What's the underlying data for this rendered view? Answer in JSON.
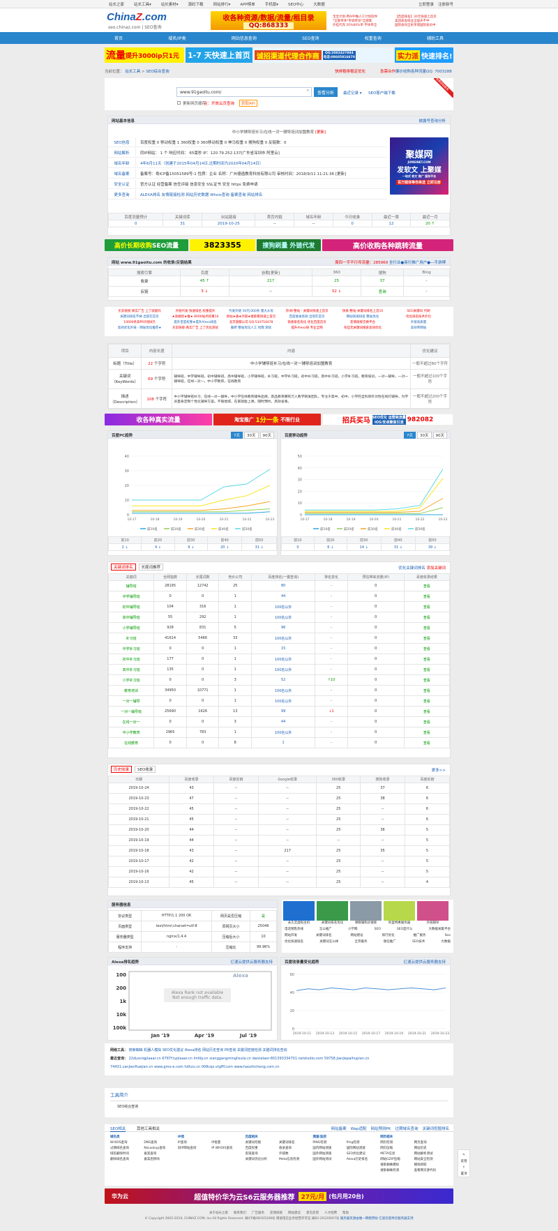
{
  "topbar": {
    "nav": [
      "站长之家",
      "站长工具▾",
      "站长素材▾",
      "源码下载",
      "网站排行▾",
      "APP榜单",
      "手机版▾",
      "SEO中心",
      "大数据"
    ],
    "login": "立即登录",
    "register": "注册新号"
  },
  "logo": {
    "main": "China",
    "z": "Z",
    "suffix": ".com",
    "sub": "seo.chinaz.com | SEO查询"
  },
  "header_ads": {
    "a1": "收各种资源/数据/流量/租目录",
    "a1_qq": "QQ:868333",
    "a2a": "宝宝计划-用APP做人工计划软件",
    "a2b": "*全部单体*单调单双*全部套",
    "a2c": "外挂代充 20%80%单 字体单全",
    "a3a": "【百度排名】30元快速上首页",
    "a3b": "美团盖会排业全国天不中",
    "a3c": "国际会同全民单调国际会员中"
  },
  "mainnav": [
    "首页",
    "域名/IP类",
    "网站信息查询",
    "SEO查询",
    "权重查询",
    "辅助工具"
  ],
  "banner": {
    "b1": "流量",
    "b1b": "提升3000ip只1元",
    "b2": "1-7 天快速上首页",
    "b2b": "诚招渠道代理合作商",
    "b2qq": "QQ:2002427884",
    "b2phone": "电话:08605816670",
    "b3": "实力派",
    "b3b": "快速排名!"
  },
  "crumb": {
    "prefix": "当前位置：",
    "home": "站长工具",
    "sep": ">",
    "current": "SEO综合查询",
    "right1": "快排稳排稳定优化",
    "right2": "SEO查询",
    "right3": "急需合作",
    "right4": "百度排名",
    "right5": "廉价收购各种流量QQ: 7003288"
  },
  "search": {
    "value": "www.91gaoitu.com/",
    "button": "查看分析",
    "history": "最近记录 ▾",
    "plugin": "SEO客户端下载",
    "hint": "更新网页缓存",
    "hint2": "注：开放云页查询",
    "hint3": "获取API",
    "ribbon": "免费获取服务"
  },
  "basic": {
    "title": "网站基本信息",
    "link": "披露号查询分析",
    "subtitle": "中小学辅导班补习/在线一对一辅导培训加盟教育",
    "update": "[更新]",
    "rows": [
      {
        "label": "SEO信息",
        "text": "百度权重  0  移动权重  1  360权重  0  360移动权重  0  神马权重  0  搜狗权重  0  反链数：0"
      },
      {
        "label": "网站解析",
        "text": "同IP网站： 1 个   响应时间： 65毫秒   IP：120.79.252.137[广东省深圳市 阿里云]"
      },
      {
        "label": "域名年龄",
        "text": "4年6月11天（创建于2015年04月14日,过期时间为2020年04月14日）"
      },
      {
        "label": "域名备案",
        "text": "备案号：粤ICP备15051589号-1   性质：企业   名称：广州德函教育科技有限公司   审核时间：2018/9/11 11:21:36  [更新]"
      },
      {
        "label": "安全认证",
        "text": "官方认证  经营备案  信任评级  信息安全  SSL证书  安全 https  免费申请"
      },
      {
        "label": "更多查询",
        "text": "ALEXA排名   友情链接检测   网站历史数据   Whois查询   备案查询   网站排名"
      }
    ],
    "adtitle": "聚媒网",
    "adsub": "JUMEINET.COM",
    "adtext": "发软文 上聚媒",
    "adtext2": "一站式 软文 推广 服务平台",
    "adtext3": "百万媒体等你来选",
    "adbtn": "立即注册",
    "stats_head": [
      "百度流量预计",
      "关键词库",
      "出站链接",
      "首页内链",
      "域名年龄",
      "今日收录",
      "最近一周",
      "最近一月"
    ],
    "stats_val": [
      "0",
      "31",
      "2019-10-25",
      "--",
      "--",
      "0",
      "12",
      "20 ↑"
    ]
  },
  "ads2": {
    "a1": "高价长期收购",
    "a1b": "SEO流量",
    "a1qq": "3823355",
    "a2": "搜狗刷量 外链代发",
    "a3": "高价收购各种跳转流量"
  },
  "index": {
    "title": "网站 www.91gaoitu.com 的收录/反链结果",
    "r1": "周四一字不行传流量：285969",
    "r2": "全行业●商行推广用户●—手游博",
    "head": [
      "搜索引擎",
      "百度",
      "谷歌[更新]",
      "360",
      "搜狗",
      "Bing"
    ],
    "rows": [
      [
        "收录",
        "45 ↑",
        "217",
        "25",
        "37",
        "-"
      ],
      [
        "反链",
        "5 ↓",
        "--",
        "52 ↓",
        "查询",
        "-"
      ]
    ]
  },
  "textads": [
    [
      "买卖链接-真实广告 上了就能吗",
      "外链代发 快速排名 权重提升",
      "代发外链 50元/300条 量大从优",
      "顶·刷·整站 - 关键词快速上首页",
      "快排-整站-关键词排名上首10",
      "SEO关键词 代刷"
    ],
    [
      "关键词排名不掉 出现在首页",
      "★高端优★推★ 8000站点权重14",
      "新站★通★外链★搜索看快速上首页",
      "百度收录高效 出现在首页",
      "网站快速排名 整站优化",
      "优化排名技术外包"
    ],
    [
      "10000条高PR外链8元",
      "提升百度权重★提升Alexa排名",
      "北京丽都公司 QQ:534754478",
      "快速排名优化 优化百度首页",
      "友情链接交换平台",
      "外链高质量"
    ],
    [
      "高效优化外链 - 网站优化推荐★",
      "买卖链接-真实广告 上了优化测试",
      "搬砖 整站优化人工 找我 测试",
      "提升Alexa快 专业全网",
      "有些无关键词搜索高效优化",
      "高效率网站"
    ]
  ],
  "meta": {
    "head": [
      "项目",
      "内容长度",
      "内容",
      "优化建议"
    ],
    "rows": [
      {
        "k": "标题（Title）",
        "len": "22",
        "unit": "个字符",
        "v": "中小学辅导班补习/在线一对一辅导培训加盟教育",
        "tip": "一般不超过80个字符"
      },
      {
        "k": "关键词（KeyWords）",
        "len": "69",
        "unit": "个字符",
        "v": "辅导班，中学辅导班，初中辅导班，高中辅导班，小学辅导班，补习班，中学补习班，初中补习班，高中补习班，小学补习班，教育培训，一对一辅导，一对一辅导班，在线一对一，中小学教育，在线教育",
        "tip": "一般不超过100个字符"
      },
      {
        "k": "描述（Description）",
        "len": "108",
        "unit": "个字符",
        "v": "中小学辅导班补习，在线一对一辅导，中小学在线教育辅导品牌。高品教育拥有万人教学研发团队，专注于高中、初中、小学的全科目针对性在线打辅导，为学员量身定制个性化辅导方案。不限地域，在家就能上课，随时预约，高效省事。",
        "tip": "一般不超过200个字符"
      }
    ]
  },
  "ads3": {
    "a1": "收各种真实流量",
    "a2": "淘宝推广",
    "a2b": "1分一条",
    "a2c": "不限行业",
    "a3": "招兵买马",
    "a4": "SEO优化 运营商流量",
    "a4b": "IOS/安卓聚焦引流",
    "a4qq": "982082"
  },
  "trend": {
    "pc_title": "百度PC趋势",
    "mb_title": "百度移动趋势",
    "tabs": [
      "7天",
      "30天",
      "90天"
    ],
    "legend": [
      "前10名",
      "前20名",
      "前30名",
      "前40名",
      "前50名"
    ],
    "rank_head": [
      "前10",
      "前20",
      "前30",
      "前40",
      "前50"
    ],
    "pc_rank": [
      "2 ↓",
      "4 ↓",
      "9 ↓",
      "20 ↓",
      "31 ↓"
    ],
    "mb_rank": [
      "0",
      "6 ↓",
      "14 ↓",
      "31 ↓",
      "39 ↓"
    ]
  },
  "chart_data": [
    {
      "type": "line",
      "title": "百度PC趋势",
      "x": [
        "10-17",
        "10-18",
        "10-19",
        "10-20",
        "10-21",
        "10-22",
        "10-23"
      ],
      "ylim": [
        0,
        40
      ],
      "yticks": [
        0,
        10,
        20,
        30,
        40
      ],
      "series": [
        {
          "name": "前10名",
          "values": [
            1,
            1,
            1,
            1,
            1,
            1,
            2
          ]
        },
        {
          "name": "前20名",
          "values": [
            2,
            2,
            2,
            2,
            2,
            3,
            4
          ]
        },
        {
          "name": "前30名",
          "values": [
            3,
            3,
            3,
            3,
            4,
            6,
            9
          ]
        },
        {
          "name": "前40名",
          "values": [
            6,
            6,
            6,
            6,
            10,
            13,
            20
          ]
        },
        {
          "name": "前50名",
          "values": [
            10,
            10,
            10,
            10,
            19,
            21,
            31
          ]
        }
      ]
    },
    {
      "type": "line",
      "title": "百度移动趋势",
      "x": [
        "10-17",
        "10-18",
        "10-19",
        "10-20",
        "10-21",
        "10-22",
        "10-23"
      ],
      "ylim": [
        0,
        50
      ],
      "yticks": [
        0,
        10,
        20,
        30,
        40,
        50
      ],
      "series": [
        {
          "name": "前10名",
          "values": [
            0,
            0,
            0,
            0,
            0,
            0,
            0
          ]
        },
        {
          "name": "前20名",
          "values": [
            1,
            1,
            1,
            1,
            1,
            1,
            6
          ]
        },
        {
          "name": "前30名",
          "values": [
            2,
            2,
            2,
            2,
            2,
            3,
            14
          ]
        },
        {
          "name": "前40名",
          "values": [
            3,
            3,
            3,
            3,
            3,
            6,
            31
          ]
        },
        {
          "name": "前50名",
          "values": [
            4,
            4,
            4,
            4,
            5,
            8,
            39
          ]
        }
      ]
    },
    {
      "type": "line",
      "title": "Alexa趋势",
      "x": [
        "Jan '19",
        "Apr '19",
        "Jul '19"
      ],
      "yticks": [
        "100",
        "200",
        "1k",
        "10k",
        "100k"
      ],
      "series": []
    },
    {
      "type": "line",
      "title": "百度收录量变化趋势",
      "x": [
        "2019-10-11",
        "2019-10-13",
        "2019-10-15",
        "2019-10-17",
        "2019-10-19",
        "2019-10-21",
        "2019-10-23"
      ],
      "ylim": [
        0,
        60
      ],
      "yticks": [
        0,
        20,
        40,
        60
      ],
      "series": [
        {
          "name": "百度收录",
          "values": [
            42,
            44,
            43,
            45,
            44,
            43,
            45,
            44,
            43,
            44,
            45,
            44,
            43,
            45
          ]
        }
      ]
    }
  ],
  "kw": {
    "tabs": [
      "关键词排名",
      "长尾词推荐"
    ],
    "r1": "优化关键词排名",
    "r2": "添加关键词",
    "head": [
      "关键词",
      "全网指数",
      "长尾词数",
      "竞价公司",
      "百度排名(一键查询)",
      "排名变化",
      "预估带来流量(IP)",
      "百度收录结果"
    ],
    "rows": [
      [
        "辅导班",
        "28195",
        "12742",
        "25",
        "80",
        "-",
        "0",
        "查看"
      ],
      [
        "中学辅导班",
        "0",
        "0",
        "1",
        "44",
        "-",
        "0",
        "查看"
      ],
      [
        "初中辅导班",
        "104",
        "316",
        "1",
        "100名以外",
        "-",
        "0",
        "查看"
      ],
      [
        "高中辅导班",
        "55",
        "292",
        "1",
        "100名以外",
        "-",
        "0",
        "查看"
      ],
      [
        "小学辅导班",
        "928",
        "831",
        "5",
        "96",
        "-",
        "0",
        "查看"
      ],
      [
        "补习班",
        "41614",
        "5466",
        "33",
        "100名以外",
        "-",
        "0",
        "查看"
      ],
      [
        "中学补习班",
        "0",
        "0",
        "1",
        "15",
        "-",
        "0",
        "查看"
      ],
      [
        "初中补习班",
        "177",
        "0",
        "1",
        "100名以外",
        "-",
        "0",
        "查看"
      ],
      [
        "高中补习班",
        "135",
        "0",
        "1",
        "100名以外",
        "-",
        "0",
        "查看"
      ],
      [
        "小学补习班",
        "0",
        "0",
        "3",
        "52",
        "↑10",
        "0",
        "查看"
      ],
      [
        "教育培训",
        "34950",
        "10771",
        "1",
        "100名以外",
        "-",
        "0",
        "查看"
      ],
      [
        "一对一辅导",
        "0",
        "0",
        "1",
        "100名以外",
        "-",
        "0",
        "查看"
      ],
      [
        "一对一辅导班",
        "25690",
        "1626",
        "13",
        "99",
        "↓1",
        "0",
        "查看"
      ],
      [
        "在线一对一",
        "0",
        "0",
        "3",
        "44",
        "-",
        "0",
        "查看"
      ],
      [
        "中小学教育",
        "2965",
        "783",
        "1",
        "100名以外",
        "-",
        "0",
        "查看"
      ],
      [
        "在线教育",
        "0",
        "0",
        "8",
        "1",
        "-",
        "0",
        "查看"
      ]
    ]
  },
  "hist": {
    "tabs": [
      "历史收录",
      "SEO收录"
    ],
    "more": "更多>>",
    "head": [
      "日期",
      "百度收录",
      "百度反链",
      "Google收录",
      "360收录",
      "搜狗收录",
      "百度反链"
    ],
    "rows": [
      [
        "2019-10-24",
        "43",
        "--",
        "--",
        "25",
        "37",
        "6"
      ],
      [
        "2019-10-23",
        "47",
        "--",
        "--",
        "25",
        "38",
        "6"
      ],
      [
        "2019-10-22",
        "45",
        "--",
        "--",
        "25",
        "--",
        "6"
      ],
      [
        "2019-10-21",
        "45",
        "--",
        "--",
        "25",
        "--",
        "6"
      ],
      [
        "2019-10-20",
        "44",
        "--",
        "--",
        "25",
        "36",
        "5"
      ],
      [
        "2019-10-19",
        "44",
        "--",
        "--",
        "--",
        "--",
        "5"
      ],
      [
        "2019-10-18",
        "43",
        "--",
        "217",
        "25",
        "35",
        "5"
      ],
      [
        "2019-10-17",
        "42",
        "--",
        "--",
        "25",
        "--",
        "5"
      ],
      [
        "2019-10-16",
        "42",
        "--",
        "--",
        "25",
        "--",
        "5"
      ],
      [
        "2019-10-13",
        "45",
        "--",
        "--",
        "25",
        "--",
        "4"
      ]
    ]
  },
  "server": {
    "title": "服务器信息",
    "rows": [
      [
        "协议类型",
        "HTTP/1.1 200 OK",
        "网页是否压缩",
        "是"
      ],
      [
        "页面类型",
        "text/html;charset=utf-8",
        "原网页大小",
        "25046"
      ],
      [
        "服务器类型",
        "nginx/1.4.4",
        "压缩后大小",
        "10"
      ],
      [
        "程序支持",
        "-",
        "压缩比",
        "99.96%"
      ]
    ],
    "thumbs": [
      "永久云虚拟主机",
      "关键词排名优化",
      "课教辅购买搜索",
      "阿里特惠服务器",
      "外链辅导"
    ],
    "links": [
      [
        "电话销售热线",
        "怎么推广",
        "小学网.",
        "SEO",
        "SEO是什么",
        "大数据采集平台"
      ],
      [
        "网站开发",
        "关键词排名",
        "网站建设",
        "排行优化",
        "推广服务",
        "Seo"
      ],
      [
        "优化快速排名",
        "关键词怎么样",
        "全宗服务",
        "微信推广",
        "SEO技术",
        "大数据"
      ]
    ]
  },
  "alexa": {
    "title": "Alexa排名趋势",
    "right": "亿速云提供云服务器支持",
    "logo": "Alexa",
    "na1": "Alexa Rank not available",
    "na2": "Not enough traffic data."
  },
  "baidu_trend": {
    "title": "百度收录量变化趋势",
    "right": "亿速云提供云服务器支持"
  },
  "friends": {
    "label1": "网络工具：",
    "t1": [
      "搜索蜘蛛",
      "机器人模拟",
      "SEO优化建议",
      "Alexa排名",
      "网站历史查询",
      "PR查询",
      "关键词密度检测",
      "关键词排名查询"
    ],
    "label2": "最近查询：",
    "t2": [
      "22duoviqplaaar.cn",
      "6787f.typlaaar.cn",
      "lmfdy.cn",
      "xianggangminglisuta.cn",
      "daixielaor-801393334701.netstudio.com",
      "59758.jianjiepaihupian.cn"
    ],
    "t3": [
      "74431.canjianfiuejian.cn",
      "www.gmo-e.com",
      "hdhzu.cn",
      "008cqo.vtgfff.com",
      "www.haozhicheng.com.cn"
    ]
  },
  "toolintro": {
    "title": "工具简介",
    "text": "SEO综合查询"
  },
  "footnav": {
    "tabs": [
      "SEO相关",
      "其他工具相关"
    ],
    "right": [
      "网站备案",
      "Wap适配",
      "网站预测PK",
      "过期域名查询",
      "关键词挖掘排名"
    ],
    "cols": [
      {
        "h": "域名类",
        "items": [
          "WHOIS查询",
          "DNS查询",
          "过期域名查询",
          "NsLookup查询",
          "域名删除时间",
          "备案查询",
          "删除域名查询",
          "备案后移除"
        ]
      },
      {
        "h": "IP类",
        "items": [
          "IP查询",
          "IP批量",
          "同IP网站查询",
          "IP WHOIS查询"
        ]
      },
      {
        "h": "百度相关",
        "items": [
          "关键词挖掘",
          "关键词排名",
          "百度权重",
          "收录查询",
          "反链查询",
          "外链数",
          "关键词优化分析",
          "Meta信息检测"
        ]
      },
      {
        "h": "测速/监控",
        "items": [
          "PING检测",
          "Ping检测",
          "国内网站测速",
          "国际网站测速",
          "国外网站测速",
          "SEO优化建议",
          "国外网站测试",
          "Alexa历史排名"
        ]
      },
      {
        "h": "网页相关",
        "items": [
          "网页检测",
          "网页查询",
          "网页压缩",
          "网站历史",
          "META信息",
          "网站解析测试",
          "网站GZIP压缩",
          "网站安全检测",
          "搜索蜘蛛模拟",
          "模拟抓取",
          "搜索蜘蛛检测",
          "查看网页源代码"
        ]
      }
    ]
  },
  "bottom_ad": {
    "brand": "华为云",
    "text": "超值特价华为云S6云服务器推荐",
    "price": "27元/月",
    "sub": "(包月用20台)"
  },
  "footer": {
    "links": [
      "关于站长之家",
      "联系我们",
      "广告服务",
      "友情链接",
      "网站建议",
      "意见反馈",
      "人才招聘",
      "帮助"
    ],
    "copy": "© Copyright 2002-2019, CHINAZ.COM, Inc.All Rights Reserved. 闽ICP备08105208号 增值电信业务经营许可证 闽B2-20120007号",
    "copy2": "服务器资源由唯一网络赞助  亿速云提供云服务器支持"
  },
  "side": {
    "a": "反馈",
    "b": "置顶"
  }
}
